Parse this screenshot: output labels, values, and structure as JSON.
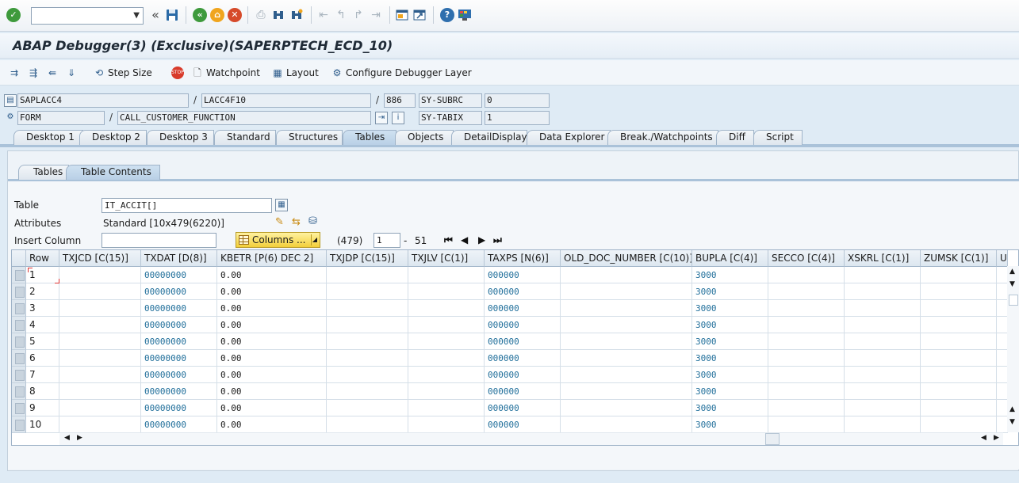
{
  "window": {
    "title": "ABAP Debugger(3)  (Exclusive)(SAPERPTECH_ECD_10)"
  },
  "system_toolbar": {
    "command_field_value": "",
    "icons": [
      "enter-check-icon",
      "double-left-icon",
      "save-icon",
      "back-icon",
      "exit-icon",
      "cancel-icon",
      "print-icon",
      "find-icon",
      "find-next-icon",
      "first-page-icon",
      "prev-page-icon",
      "next-page-icon",
      "last-page-icon",
      "new-session-icon",
      "shortcut-icon",
      "help-icon",
      "customize-layout-icon"
    ]
  },
  "app_toolbar": {
    "step_size": "Step Size",
    "watchpoint": "Watchpoint",
    "layout": "Layout",
    "configure": "Configure Debugger Layer"
  },
  "context": {
    "program": "SAPLACC4",
    "include": "LACC4F10",
    "line": "886",
    "subrc_label": "SY-SUBRC",
    "subrc_value": "0",
    "event_type": "FORM",
    "event_name": "CALL_CUSTOMER_FUNCTION",
    "tabix_label": "SY-TABIX",
    "tabix_value": "1",
    "slash": "/"
  },
  "tabs": [
    {
      "label": "Desktop 1",
      "active": false
    },
    {
      "label": "Desktop 2",
      "active": false
    },
    {
      "label": "Desktop 3",
      "active": false
    },
    {
      "label": "Standard",
      "active": false
    },
    {
      "label": "Structures",
      "active": false
    },
    {
      "label": "Tables",
      "active": true
    },
    {
      "label": "Objects",
      "active": false
    },
    {
      "label": "DetailDisplay",
      "active": false
    },
    {
      "label": "Data Explorer",
      "active": false
    },
    {
      "label": "Break./Watchpoints",
      "active": false
    },
    {
      "label": "Diff",
      "active": false
    },
    {
      "label": "Script",
      "active": false
    }
  ],
  "subtabs": [
    {
      "label": "Tables",
      "active": false
    },
    {
      "label": "Table Contents",
      "active": true
    }
  ],
  "table_panel": {
    "table_label": "Table",
    "table_value": "IT_ACCIT[]",
    "attributes_label": "Attributes",
    "attributes_value": "Standard [10x479(6220)]",
    "insert_column_label": "Insert Column",
    "insert_column_value": "",
    "columns_button": "Columns ...",
    "column_count": "(479)",
    "from_value": "1",
    "dash": "-",
    "to_value": "51"
  },
  "grid": {
    "headers": [
      "Row",
      "TXJCD [C(15)]",
      "TXDAT [D(8)]",
      "KBETR [P(6) DEC 2]",
      "TXJDP [C(15)]",
      "TXJLV [C(1)]",
      "TAXPS [N(6)]",
      "OLD_DOC_NUMBER [C(10)]",
      "BUPLA [C(4)]",
      "SECCO [C(4)]",
      "XSKRL [C(1)]",
      "ZUMSK [C(1)]",
      "UM"
    ],
    "rows": [
      [
        "1",
        "",
        "00000000",
        "0.00",
        "",
        "",
        "000000",
        "",
        "3000",
        "",
        "",
        "",
        ""
      ],
      [
        "2",
        "",
        "00000000",
        "0.00",
        "",
        "",
        "000000",
        "",
        "3000",
        "",
        "",
        "",
        ""
      ],
      [
        "3",
        "",
        "00000000",
        "0.00",
        "",
        "",
        "000000",
        "",
        "3000",
        "",
        "",
        "",
        ""
      ],
      [
        "4",
        "",
        "00000000",
        "0.00",
        "",
        "",
        "000000",
        "",
        "3000",
        "",
        "",
        "",
        ""
      ],
      [
        "5",
        "",
        "00000000",
        "0.00",
        "",
        "",
        "000000",
        "",
        "3000",
        "",
        "",
        "",
        ""
      ],
      [
        "6",
        "",
        "00000000",
        "0.00",
        "",
        "",
        "000000",
        "",
        "3000",
        "",
        "",
        "",
        ""
      ],
      [
        "7",
        "",
        "00000000",
        "0.00",
        "",
        "",
        "000000",
        "",
        "3000",
        "",
        "",
        "",
        ""
      ],
      [
        "8",
        "",
        "00000000",
        "0.00",
        "",
        "",
        "000000",
        "",
        "3000",
        "",
        "",
        "",
        ""
      ],
      [
        "9",
        "",
        "00000000",
        "0.00",
        "",
        "",
        "000000",
        "",
        "3000",
        "",
        "",
        "",
        ""
      ],
      [
        "10",
        "",
        "00000000",
        "0.00",
        "",
        "",
        "000000",
        "",
        "3000",
        "",
        "",
        "",
        ""
      ]
    ]
  },
  "colors": {
    "accent": "#1f6e9a",
    "columns_button": "#f3cf3a"
  }
}
